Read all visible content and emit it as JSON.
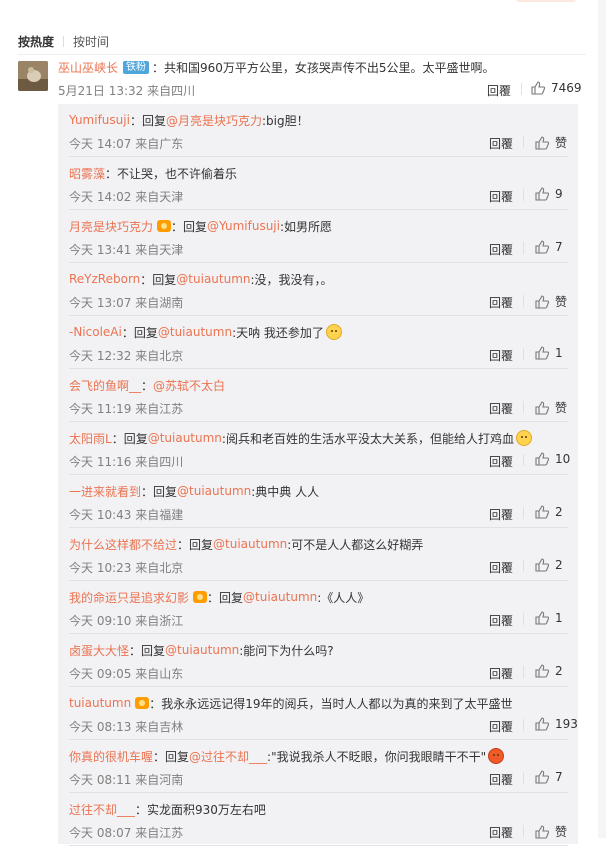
{
  "sort": {
    "hot": "按热度",
    "time": "按时间"
  },
  "main_comment": {
    "username": "巫山巫峡长",
    "badge": "铁粉",
    "text": "：共和国960万平方公里，女孩哭声传不出5公里。太平盛世啊。",
    "meta": "5月21日 13:32 来自四川",
    "reply_label": "回覆",
    "likes": "7469"
  },
  "replies": [
    {
      "user": "Yumifusuji",
      "pre": "：回复",
      "at": "@月亮是块巧克力",
      "text": ":big胆！",
      "meta": "今天 14:07 来自广东",
      "reply_label": "回覆",
      "likes": "赞"
    },
    {
      "user": "昭雾藻",
      "pre": "：不让哭，也不许偷着乐",
      "at": "",
      "text": "",
      "meta": "今天 14:02 来自天津",
      "reply_label": "回覆",
      "likes": "9"
    },
    {
      "user": "月亮是块巧克力",
      "pre": "：回复",
      "at": "@Yumifusuji",
      "text": ":如男所愿",
      "meta": "今天 13:41 来自天津",
      "reply_label": "回覆",
      "likes": "7",
      "vip": true
    },
    {
      "user": "ReYzReborn",
      "pre": "：回复",
      "at": "@tuiautumn",
      "text": ":没，我没有，。",
      "meta": "今天 13:07 来自湖南",
      "reply_label": "回覆",
      "likes": "赞"
    },
    {
      "user": "-NicoleAi",
      "pre": "：回复",
      "at": "@tuiautumn",
      "text": ":天呐 我还参加了",
      "meta": "今天 12:32 来自北京",
      "reply_label": "回覆",
      "likes": "1",
      "emoji": "yellow"
    },
    {
      "user": "会飞的鱼啊__",
      "pre": "：",
      "at": "@苏轼不太白",
      "text": "",
      "meta": "今天 11:19 来自江苏",
      "reply_label": "回覆",
      "likes": "赞"
    },
    {
      "user": "太阳雨L",
      "pre": "：回复",
      "at": "@tuiautumn",
      "text": ":阅兵和老百姓的生活水平没太大关系，但能给人打鸡血",
      "meta": "今天 11:16 来自四川",
      "reply_label": "回覆",
      "likes": "10",
      "emoji": "yellow"
    },
    {
      "user": "一进来就看到",
      "pre": "：回复",
      "at": "@tuiautumn",
      "text": ":典中典 人人",
      "meta": "今天 10:43 来自福建",
      "reply_label": "回覆",
      "likes": "2"
    },
    {
      "user": "为什么这样都不给过",
      "pre": "：回复",
      "at": "@tuiautumn",
      "text": ":可不是人人都这么好糊弄",
      "meta": "今天 10:23 来自北京",
      "reply_label": "回覆",
      "likes": "2"
    },
    {
      "user": "我的命运只是追求幻影",
      "pre": "：回复",
      "at": "@tuiautumn",
      "text": ":《人人》",
      "meta": "今天 09:10 来自浙江",
      "reply_label": "回覆",
      "likes": "1",
      "vip": true
    },
    {
      "user": "卤蛋大大怪",
      "pre": "：回复 ",
      "at": "@tuiautumn",
      "text": ":能问下为什么吗?",
      "meta": "今天 09:05 来自山东",
      "reply_label": "回覆",
      "likes": "2"
    },
    {
      "user": "tuiautumn",
      "pre": "：我永永远远记得19年的阅兵，当时人人都以为真的来到了太平盛世",
      "at": "",
      "text": "",
      "meta": "今天 08:13 来自吉林",
      "reply_label": "回覆",
      "likes": "193",
      "vip": true
    },
    {
      "user": "你真的很机车喔",
      "pre": "：回复",
      "at": "@过往不却___",
      "text": ":\"我说我杀人不眨眼，你问我眼睛干不干\"",
      "meta": "今天 08:11 来自河南",
      "reply_label": "回覆",
      "likes": "7",
      "emoji": "red"
    },
    {
      "user": "过往不却___",
      "pre": "：实龙面积930万左右吧",
      "at": "",
      "text": "",
      "meta": "今天 08:07 来自江苏",
      "reply_label": "回覆",
      "likes": "赞"
    }
  ]
}
